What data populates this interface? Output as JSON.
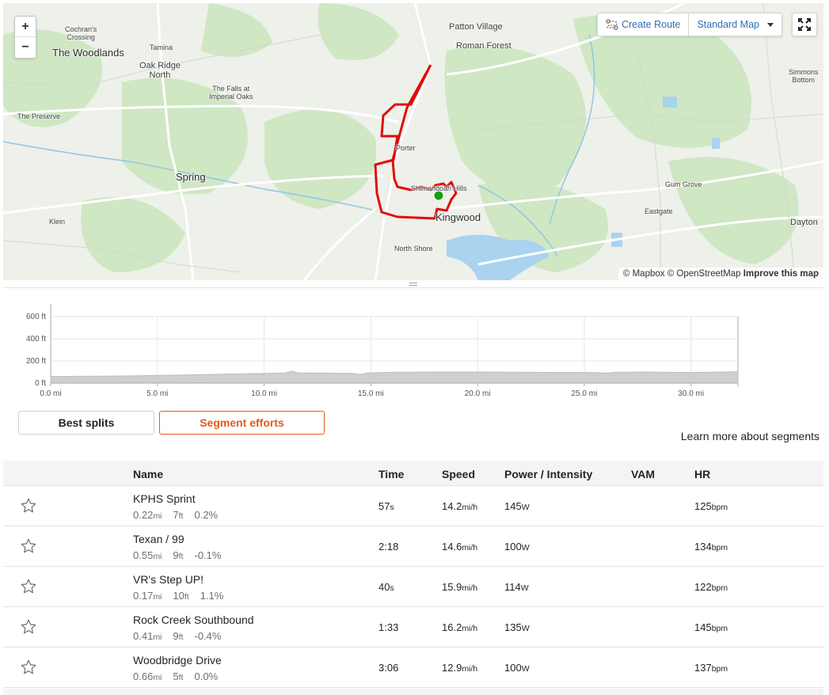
{
  "map": {
    "zoom_in": "+",
    "zoom_out": "−",
    "create_route": "Create Route",
    "map_type": "Standard Map",
    "attribution": {
      "mapbox": "© Mapbox",
      "osm": "© OpenStreetMap",
      "improve": "Improve this map"
    },
    "labels": [
      {
        "id": "cochrans",
        "text": "Cochran's\nCrossing"
      },
      {
        "id": "woodlands",
        "text": "The Woodlands"
      },
      {
        "id": "tamina",
        "text": "Tamina"
      },
      {
        "id": "oakridge",
        "text": "Oak Ridge\nNorth"
      },
      {
        "id": "falls",
        "text": "The Falls at\nImperial Oaks"
      },
      {
        "id": "preserve",
        "text": "The Preserve"
      },
      {
        "id": "spring",
        "text": "Spring"
      },
      {
        "id": "klein",
        "text": "Klein"
      },
      {
        "id": "patton",
        "text": "Patton Village"
      },
      {
        "id": "roman",
        "text": "Roman Forest"
      },
      {
        "id": "porter",
        "text": "Porter"
      },
      {
        "id": "shenandoah",
        "text": "Shenandoah Hills"
      },
      {
        "id": "kingwood",
        "text": "Kingwood"
      },
      {
        "id": "northshore",
        "text": "North Shore"
      },
      {
        "id": "simmons",
        "text": "Simmons\nBottom"
      },
      {
        "id": "gumgrove",
        "text": "Gum Grove"
      },
      {
        "id": "eastgate",
        "text": "Eastgate"
      },
      {
        "id": "dayton",
        "text": "Dayton"
      }
    ],
    "colors": {
      "route": "#e00d0d",
      "start_marker": "#12a012",
      "water": "#a7d2ee",
      "park": "#cde8c1"
    }
  },
  "elevation": {
    "y_ticks": [
      "600 ft",
      "400 ft",
      "200 ft",
      "0 ft"
    ],
    "x_ticks": [
      "0.0 mi",
      "5.0 mi",
      "10.0 mi",
      "15.0 mi",
      "20.0 mi",
      "25.0 mi",
      "30.0 mi"
    ],
    "y_max": 600,
    "x_max": 32.2,
    "profile": [
      [
        0,
        60
      ],
      [
        2,
        62
      ],
      [
        4,
        66
      ],
      [
        6,
        72
      ],
      [
        8,
        80
      ],
      [
        10,
        88
      ],
      [
        11,
        92
      ],
      [
        11.3,
        108
      ],
      [
        11.6,
        92
      ],
      [
        13,
        90
      ],
      [
        14.2,
        88
      ],
      [
        14.5,
        78
      ],
      [
        14.8,
        90
      ],
      [
        16,
        98
      ],
      [
        18,
        100
      ],
      [
        20,
        100
      ],
      [
        22,
        98
      ],
      [
        24,
        96
      ],
      [
        25.5,
        96
      ],
      [
        26,
        90
      ],
      [
        26.5,
        98
      ],
      [
        28,
        100
      ],
      [
        30,
        96
      ],
      [
        32,
        102
      ],
      [
        32.2,
        102
      ]
    ]
  },
  "tabs": {
    "best_splits": "Best splits",
    "segment_efforts": "Segment efforts"
  },
  "learn_more": "Learn more about segments",
  "table": {
    "headers": {
      "name": "Name",
      "time": "Time",
      "speed": "Speed",
      "power": "Power / Intensity",
      "vam": "VAM",
      "hr": "HR"
    },
    "rows": [
      {
        "name": "KPHS Sprint",
        "dist": "0.22",
        "dist_unit": "mi",
        "elev": "7",
        "elev_unit": "ft",
        "grade": "0.2%",
        "time": "57",
        "time_unit": "s",
        "speed": "14.2",
        "speed_unit": "mi/h",
        "power": "145",
        "power_unit": "W",
        "hr": "125",
        "hr_unit": "bpm"
      },
      {
        "name": "Texan / 99",
        "dist": "0.55",
        "dist_unit": "mi",
        "elev": "9",
        "elev_unit": "ft",
        "grade": "-0.1%",
        "time": "2:18",
        "time_unit": "",
        "speed": "14.6",
        "speed_unit": "mi/h",
        "power": "100",
        "power_unit": "W",
        "hr": "134",
        "hr_unit": "bpm"
      },
      {
        "name": "VR's Step UP!",
        "dist": "0.17",
        "dist_unit": "mi",
        "elev": "10",
        "elev_unit": "ft",
        "grade": "1.1%",
        "time": "40",
        "time_unit": "s",
        "speed": "15.9",
        "speed_unit": "mi/h",
        "power": "114",
        "power_unit": "W",
        "hr": "122",
        "hr_unit": "bpm"
      },
      {
        "name": "Rock Creek Southbound",
        "dist": "0.41",
        "dist_unit": "mi",
        "elev": "9",
        "elev_unit": "ft",
        "grade": "-0.4%",
        "time": "1:33",
        "time_unit": "",
        "speed": "16.2",
        "speed_unit": "mi/h",
        "power": "135",
        "power_unit": "W",
        "hr": "145",
        "hr_unit": "bpm"
      },
      {
        "name": "Woodbridge Drive",
        "dist": "0.66",
        "dist_unit": "mi",
        "elev": "5",
        "elev_unit": "ft",
        "grade": "0.0%",
        "time": "3:06",
        "time_unit": "",
        "speed": "12.9",
        "speed_unit": "mi/h",
        "power": "100",
        "power_unit": "W",
        "hr": "137",
        "hr_unit": "bpm"
      }
    ]
  }
}
